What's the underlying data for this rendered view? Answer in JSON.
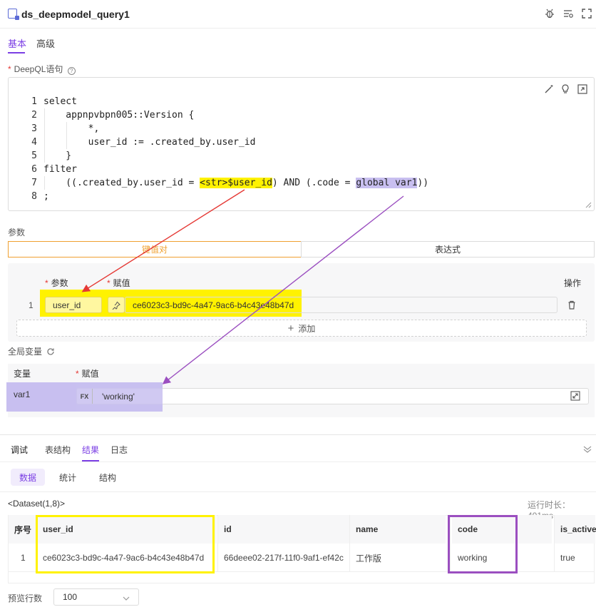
{
  "header": {
    "title": "ds_deepmodel_query1",
    "icons": [
      "bug-icon",
      "list-settings-icon",
      "fullscreen-icon"
    ]
  },
  "tabs_top": [
    "基本",
    "高级"
  ],
  "query_label": "DeepQL语句",
  "code": {
    "lines": [
      {
        "no": "1",
        "text": "select"
      },
      {
        "no": "2",
        "text": "    appnpvbpn005::Version {"
      },
      {
        "no": "3",
        "text": "        *,"
      },
      {
        "no": "4",
        "text": "        user_id := .created_by.user_id"
      },
      {
        "no": "5",
        "text": "    }"
      },
      {
        "no": "6",
        "text": "filter"
      },
      {
        "no": "7",
        "pre": "    ((.created_by.user_id = ",
        "hl1": "<str>$user_id",
        "mid": ") AND (.code = ",
        "hl2": "global var1",
        "post": "))"
      },
      {
        "no": "8",
        "text": ";"
      }
    ],
    "toolbar_icons": [
      "magic-wand-icon",
      "lightbulb-icon",
      "expand-icon"
    ]
  },
  "params": {
    "label": "参数",
    "segments": [
      "键值对",
      "表达式"
    ],
    "col_param": "参数",
    "col_value": "赋值",
    "col_action": "操作",
    "rows": [
      {
        "index": "1",
        "name": "user_id",
        "value": "ce6023c3-bd9c-4a47-9ac6-b4c43e48b47d"
      }
    ],
    "add_label": "添加"
  },
  "global_vars": {
    "label": "全局变量",
    "col_var": "变量",
    "col_value": "赋值",
    "rows": [
      {
        "name": "var1",
        "fx": "FX",
        "value": "'working'"
      }
    ]
  },
  "bottom_tabs": [
    "调试",
    "表结构",
    "结果",
    "日志"
  ],
  "result_pills": [
    "数据",
    "统计",
    "结构"
  ],
  "dataset": {
    "label": "<Dataset(1,8)>",
    "runtime": "运行时长：401ms",
    "columns": [
      "序号",
      "user_id",
      "id",
      "name",
      "code",
      "is_active"
    ],
    "rows": [
      [
        "1",
        "ce6023c3-bd9c-4a47-9ac6-b4c43e48b47d",
        "66deee02-217f-11f0-9af1-ef42c",
        "工作版",
        "working",
        "true"
      ]
    ]
  },
  "preview": {
    "label": "预览行数",
    "value": "100"
  },
  "colors": {
    "accent": "#7b3fe4",
    "orange": "#f0a030",
    "highlight_yellow": "#fff200",
    "highlight_purple": "#c8bff0",
    "annotation_red": "#e53935",
    "annotation_purple": "#9b4fc0"
  }
}
